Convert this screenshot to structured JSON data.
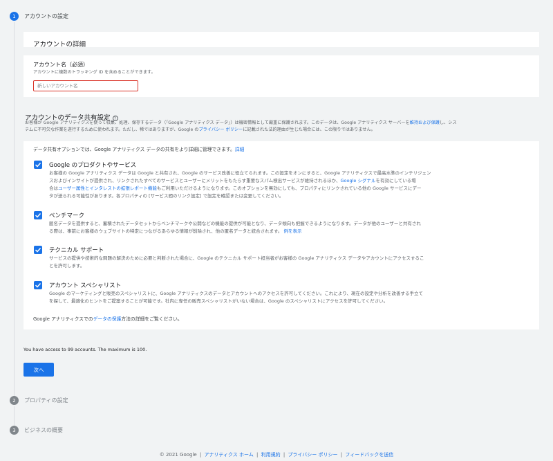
{
  "steps": [
    {
      "num": "1",
      "label": "アカウントの設定"
    },
    {
      "num": "2",
      "label": "プロパティの設定"
    },
    {
      "num": "3",
      "label": "ビジネスの概要"
    }
  ],
  "account_details": {
    "title": "アカウントの詳細"
  },
  "account_name": {
    "title": "アカウント名（必須）",
    "hint": "アカウントに複数のトラッキング ID を含めることができます。",
    "placeholder": "新しいアカウント名"
  },
  "data_sharing": {
    "title": "アカウントのデータ共有設定",
    "desc_part1": "お客様が Google アナリティクスを使って収集、処理、保存するデータ（「Google アナリティクス データ」）は機密情報として厳重に保護されます。このデータは、Google アナリティクス サーバーを",
    "desc_link1": "維持および保護",
    "desc_part2": "し、シス",
    "desc_part3": "テムに不可欠な作業を遂行するために使われます。ただし、稀ではありますが、Google の",
    "desc_link2": "プライバシー ポリシー",
    "desc_part4": "に記載された法的理由が生じた場合には、この限りではありません。",
    "intro": "データ共有オプションでは、Google アナリティクス データの共有をより詳細に管理できます。",
    "intro_link": "詳細",
    "options": [
      {
        "title": "Google のプロダクトやサービス",
        "lines": [
          "お客様の Google アナリティクス データは Google と共有され、Google のサービス改善に役立てられます。この設定をオンにすると、Google アナリティクスで最高水準のインテリジェン",
          "スおよびインサイトが提供され、リンクされたすべてのサービスとユーザーにメリットをもたらす重要なスパム検出サービスが維持されるほか、",
          "合は",
          "もご利用いただけるようになります。このオプションを無効にしても、プロパティにリンクされている他の Google サービスにデー",
          "タが送られる可能性があります。各プロパティの [サービス間のリンク設定] で設定を確認または変更してください。"
        ],
        "link_a": "Google シグナル",
        "link_a_after": "を有効にしている場",
        "link_b": "ユーザー属性とインタレストの拡張レポート機能"
      },
      {
        "title": "ベンチマーク",
        "lines": [
          "匿名データを提供すると、蓄積されたデータセットからベンチマークや公開などの機能の提供が可能となり、データ傾向も把握できるようになります。データが他のユーザーと共有され",
          "る際は、事前にお客様のウェブサイトの特定につながるあらゆる情報が削除され、他の匿名データと統合されます。"
        ],
        "link": "例を表示"
      },
      {
        "title": "テクニカル サポート",
        "lines": [
          "サービスの提供や技術的な問題の解決のために必要と判断された場合に、Google のテクニカル サポート担当者がお客様の Google アナリティクス データやアカウントにアクセスするこ",
          "とを許可します。"
        ]
      },
      {
        "title": "アカウント スペシャリスト",
        "lines": [
          "Google のマーケティングと販売のスペシャリストに、Google アナリティクスのデータとアカウントへのアクセスを許可してください。これにより、現在の設定や分析を改善する手立て",
          "を探して、最適化のヒントをご提案することが可能です。社内に専任の販売スペシャリストがいない場合は、Google のスペシャリストにアクセスを許可してください。"
        ]
      }
    ],
    "footer_part1": "Google アナリティクスでの",
    "footer_link": "データの保護",
    "footer_part2": "方法の詳細をご覧ください。"
  },
  "access_note": "You have access to 99 accounts. The maximum is 100.",
  "next_button": "次へ",
  "footer": {
    "copyright": "© 2021 Google",
    "links": [
      "アナリティクス ホーム",
      "利用規約",
      "プライバシー ポリシー",
      "フィードバックを送信"
    ]
  }
}
